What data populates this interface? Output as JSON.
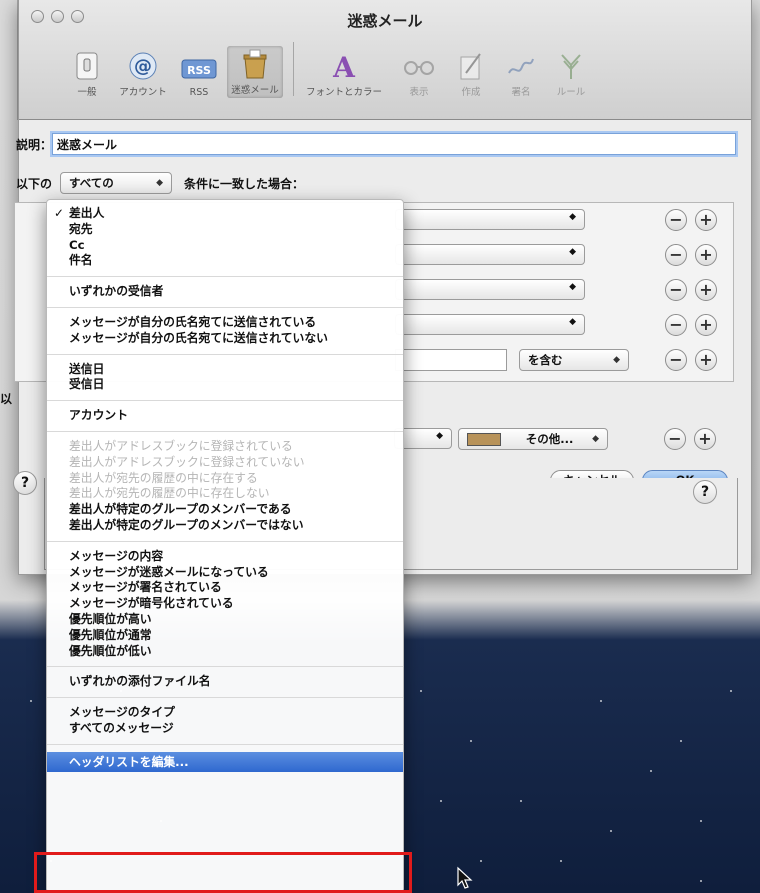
{
  "window": {
    "title": "迷惑メール"
  },
  "toolbar": {
    "items": [
      {
        "label": "一般",
        "icon": "general-switch-icon",
        "state": "normal"
      },
      {
        "label": "アカウント",
        "icon": "at-sign-icon",
        "state": "normal"
      },
      {
        "label": "RSS",
        "icon": "rss-icon",
        "state": "normal"
      },
      {
        "label": "迷惑メール",
        "icon": "junk-mail-icon",
        "state": "selected"
      },
      {
        "label": "フォントとカラー",
        "icon": "fonts-colors-icon",
        "state": "normal"
      },
      {
        "label": "表示",
        "icon": "glasses-icon",
        "state": "dim"
      },
      {
        "label": "作成",
        "icon": "compose-icon",
        "state": "dim"
      },
      {
        "label": "署名",
        "icon": "signature-icon",
        "state": "dim"
      },
      {
        "label": "ルール",
        "icon": "rules-icon",
        "state": "dim"
      }
    ]
  },
  "form": {
    "description_label": "説明：",
    "description_value": "迷惑メール",
    "condition_prefix": "以下の",
    "condition_select": "すべての",
    "condition_suffix": "条件に一致した場合：",
    "partial_label_1": "以",
    "text_operator": "を含む",
    "color_option": "その他...",
    "cancel_label": "キャンセル",
    "ok_label": "OK",
    "help_label": "?"
  },
  "menu": {
    "check_mark": "✓",
    "groups": [
      [
        {
          "label": "差出人",
          "checked": true,
          "enabled": true
        },
        {
          "label": "宛先",
          "checked": false,
          "enabled": true
        },
        {
          "label": "Cc",
          "checked": false,
          "enabled": true
        },
        {
          "label": "件名",
          "checked": false,
          "enabled": true
        }
      ],
      [
        {
          "label": "いずれかの受信者",
          "checked": false,
          "enabled": true
        }
      ],
      [
        {
          "label": "メッセージが自分の氏名宛てに送信されている",
          "checked": false,
          "enabled": true
        },
        {
          "label": "メッセージが自分の氏名宛てに送信されていない",
          "checked": false,
          "enabled": true
        }
      ],
      [
        {
          "label": "送信日",
          "checked": false,
          "enabled": true
        },
        {
          "label": "受信日",
          "checked": false,
          "enabled": true
        }
      ],
      [
        {
          "label": "アカウント",
          "checked": false,
          "enabled": true
        }
      ],
      [
        {
          "label": "差出人がアドレスブックに登録されている",
          "checked": false,
          "enabled": false
        },
        {
          "label": "差出人がアドレスブックに登録されていない",
          "checked": false,
          "enabled": false
        },
        {
          "label": "差出人が宛先の履歴の中に存在する",
          "checked": false,
          "enabled": false
        },
        {
          "label": "差出人が宛先の履歴の中に存在しない",
          "checked": false,
          "enabled": false
        },
        {
          "label": "差出人が特定のグループのメンバーである",
          "checked": false,
          "enabled": true
        },
        {
          "label": "差出人が特定のグループのメンバーではない",
          "checked": false,
          "enabled": true
        }
      ],
      [
        {
          "label": "メッセージの内容",
          "checked": false,
          "enabled": true
        },
        {
          "label": "メッセージが迷惑メールになっている",
          "checked": false,
          "enabled": true
        },
        {
          "label": "メッセージが署名されている",
          "checked": false,
          "enabled": true
        },
        {
          "label": "メッセージが暗号化されている",
          "checked": false,
          "enabled": true
        },
        {
          "label": "優先順位が高い",
          "checked": false,
          "enabled": true
        },
        {
          "label": "優先順位が通常",
          "checked": false,
          "enabled": true
        },
        {
          "label": "優先順位が低い",
          "checked": false,
          "enabled": true
        }
      ],
      [
        {
          "label": "いずれかの添付ファイル名",
          "checked": false,
          "enabled": true
        }
      ],
      [
        {
          "label": "メッセージのタイプ",
          "checked": false,
          "enabled": true
        },
        {
          "label": "すべてのメッセージ",
          "checked": false,
          "enabled": true
        }
      ]
    ],
    "highlighted_item": "ヘッダリストを編集..."
  },
  "colors": {
    "highlight": "#2f68cf",
    "annotation": "#e11b1b",
    "color_swatch": "#b8935a",
    "focus": "#79a2d9"
  }
}
